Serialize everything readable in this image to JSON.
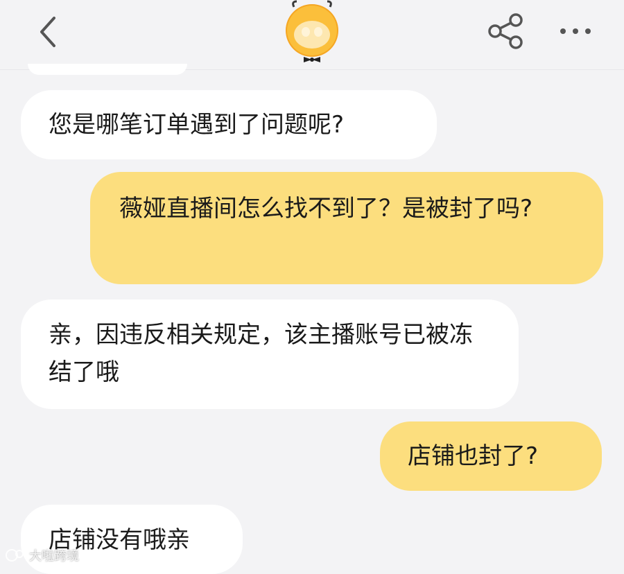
{
  "header": {
    "back_icon": "chevron-left-icon",
    "avatar_icon": "yellow-mascot-avatar",
    "share_icon": "share-icon",
    "more_icon": "more-dots-icon"
  },
  "messages": [
    {
      "side": "in",
      "text": "您是哪笔订单遇到了问题呢?"
    },
    {
      "side": "out",
      "text": "薇娅直播间怎么找不到了？是被封了吗?"
    },
    {
      "side": "in",
      "text": "亲，因违反相关规定，该主播账号已被冻结了哦"
    },
    {
      "side": "out",
      "text": "店铺也封了?"
    },
    {
      "side": "in",
      "text": "店铺没有哦亲"
    }
  ],
  "colors": {
    "background": "#f3f3f5",
    "incoming_bubble": "#ffffff",
    "outgoing_bubble": "#fcde7e",
    "icon": "#555555"
  },
  "watermark": {
    "text": "大啦跨境"
  }
}
